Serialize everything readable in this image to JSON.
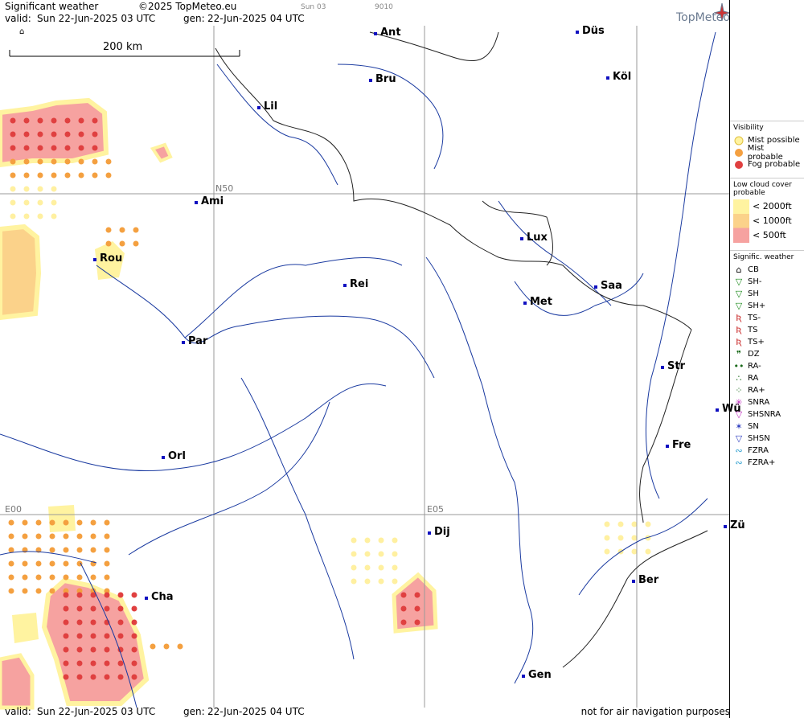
{
  "header": {
    "title": "Significant weather",
    "copyright": "©2025 TopMeteo.eu",
    "small_a": "Sun 03",
    "small_b": "9010",
    "valid_label": "valid:",
    "valid_value": "Sun  22-Jun-2025  03 UTC",
    "gen_label": "gen:",
    "gen_value": "22-Jun-2025 04 UTC",
    "brand": "TopMeteo"
  },
  "scale": {
    "label": "200 km"
  },
  "grid": {
    "lat_label": "N50",
    "lon_w": "E00",
    "lon_e": "E05"
  },
  "cities": [
    "Ant",
    "Düs",
    "Bru",
    "Köl",
    "Lil",
    "Ami",
    "Lux",
    "Rou",
    "Rei",
    "Saa",
    "Met",
    "Par",
    "Str",
    "Wü",
    "Fre",
    "Orl",
    "Dij",
    "Cha",
    "Ber",
    "Gen",
    "Zü"
  ],
  "legend": {
    "visibility_title": "Visibility",
    "mist_possible": "Mist possible",
    "mist_probable": "Mist probable",
    "fog_probable": "Fog probable",
    "low_cloud_title": "Low cloud cover probable",
    "lc1": "< 2000ft",
    "lc2": "< 1000ft",
    "lc3": "<  500ft",
    "sigwx_title": "Signific. weather",
    "items": [
      "CB",
      "SH-",
      "SH",
      "SH+",
      "TS-",
      "TS",
      "TS+",
      "DZ",
      "RA-",
      "RA",
      "RA+",
      "SNRA",
      "SHSNRA",
      "SN",
      "SHSN",
      "FZRA",
      "FZRA+"
    ]
  },
  "footer": {
    "valid_label": "valid:",
    "valid_value": "Sun  22-Jun-2025  03 UTC",
    "gen_label": "gen:",
    "gen_value": "22-Jun-2025 04 UTC",
    "disclaimer": "not for air navigation purposes"
  },
  "colors": {
    "fog": "#f07070",
    "mist_prob": "#f4a040",
    "mist_poss": "#fff3a0",
    "river": "#1a3aa0",
    "border": "#000",
    "grid": "#999"
  }
}
